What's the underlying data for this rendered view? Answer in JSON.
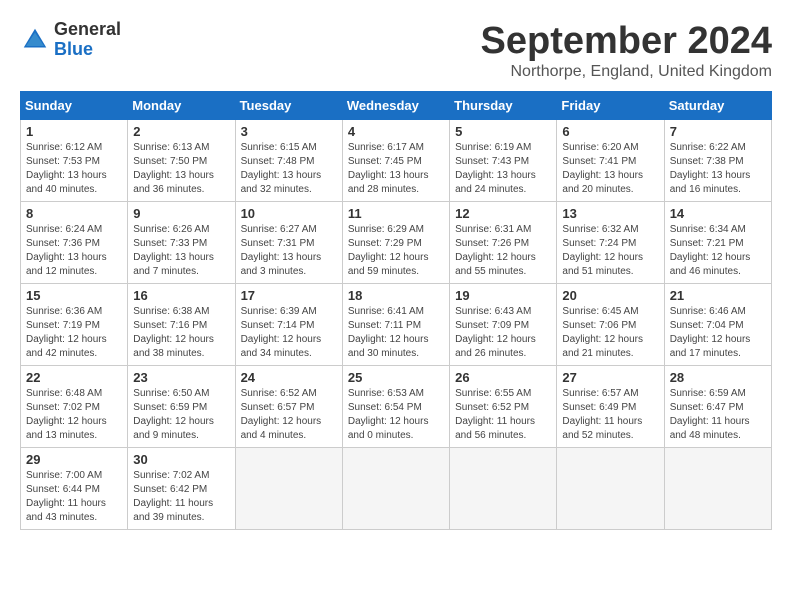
{
  "logo": {
    "line1": "General",
    "line2": "Blue"
  },
  "header": {
    "month": "September 2024",
    "location": "Northorpe, England, United Kingdom"
  },
  "weekdays": [
    "Sunday",
    "Monday",
    "Tuesday",
    "Wednesday",
    "Thursday",
    "Friday",
    "Saturday"
  ],
  "weeks": [
    [
      {
        "day": "1",
        "info": "Sunrise: 6:12 AM\nSunset: 7:53 PM\nDaylight: 13 hours\nand 40 minutes."
      },
      {
        "day": "2",
        "info": "Sunrise: 6:13 AM\nSunset: 7:50 PM\nDaylight: 13 hours\nand 36 minutes."
      },
      {
        "day": "3",
        "info": "Sunrise: 6:15 AM\nSunset: 7:48 PM\nDaylight: 13 hours\nand 32 minutes."
      },
      {
        "day": "4",
        "info": "Sunrise: 6:17 AM\nSunset: 7:45 PM\nDaylight: 13 hours\nand 28 minutes."
      },
      {
        "day": "5",
        "info": "Sunrise: 6:19 AM\nSunset: 7:43 PM\nDaylight: 13 hours\nand 24 minutes."
      },
      {
        "day": "6",
        "info": "Sunrise: 6:20 AM\nSunset: 7:41 PM\nDaylight: 13 hours\nand 20 minutes."
      },
      {
        "day": "7",
        "info": "Sunrise: 6:22 AM\nSunset: 7:38 PM\nDaylight: 13 hours\nand 16 minutes."
      }
    ],
    [
      {
        "day": "8",
        "info": "Sunrise: 6:24 AM\nSunset: 7:36 PM\nDaylight: 13 hours\nand 12 minutes."
      },
      {
        "day": "9",
        "info": "Sunrise: 6:26 AM\nSunset: 7:33 PM\nDaylight: 13 hours\nand 7 minutes."
      },
      {
        "day": "10",
        "info": "Sunrise: 6:27 AM\nSunset: 7:31 PM\nDaylight: 13 hours\nand 3 minutes."
      },
      {
        "day": "11",
        "info": "Sunrise: 6:29 AM\nSunset: 7:29 PM\nDaylight: 12 hours\nand 59 minutes."
      },
      {
        "day": "12",
        "info": "Sunrise: 6:31 AM\nSunset: 7:26 PM\nDaylight: 12 hours\nand 55 minutes."
      },
      {
        "day": "13",
        "info": "Sunrise: 6:32 AM\nSunset: 7:24 PM\nDaylight: 12 hours\nand 51 minutes."
      },
      {
        "day": "14",
        "info": "Sunrise: 6:34 AM\nSunset: 7:21 PM\nDaylight: 12 hours\nand 46 minutes."
      }
    ],
    [
      {
        "day": "15",
        "info": "Sunrise: 6:36 AM\nSunset: 7:19 PM\nDaylight: 12 hours\nand 42 minutes."
      },
      {
        "day": "16",
        "info": "Sunrise: 6:38 AM\nSunset: 7:16 PM\nDaylight: 12 hours\nand 38 minutes."
      },
      {
        "day": "17",
        "info": "Sunrise: 6:39 AM\nSunset: 7:14 PM\nDaylight: 12 hours\nand 34 minutes."
      },
      {
        "day": "18",
        "info": "Sunrise: 6:41 AM\nSunset: 7:11 PM\nDaylight: 12 hours\nand 30 minutes."
      },
      {
        "day": "19",
        "info": "Sunrise: 6:43 AM\nSunset: 7:09 PM\nDaylight: 12 hours\nand 26 minutes."
      },
      {
        "day": "20",
        "info": "Sunrise: 6:45 AM\nSunset: 7:06 PM\nDaylight: 12 hours\nand 21 minutes."
      },
      {
        "day": "21",
        "info": "Sunrise: 6:46 AM\nSunset: 7:04 PM\nDaylight: 12 hours\nand 17 minutes."
      }
    ],
    [
      {
        "day": "22",
        "info": "Sunrise: 6:48 AM\nSunset: 7:02 PM\nDaylight: 12 hours\nand 13 minutes."
      },
      {
        "day": "23",
        "info": "Sunrise: 6:50 AM\nSunset: 6:59 PM\nDaylight: 12 hours\nand 9 minutes."
      },
      {
        "day": "24",
        "info": "Sunrise: 6:52 AM\nSunset: 6:57 PM\nDaylight: 12 hours\nand 4 minutes."
      },
      {
        "day": "25",
        "info": "Sunrise: 6:53 AM\nSunset: 6:54 PM\nDaylight: 12 hours\nand 0 minutes."
      },
      {
        "day": "26",
        "info": "Sunrise: 6:55 AM\nSunset: 6:52 PM\nDaylight: 11 hours\nand 56 minutes."
      },
      {
        "day": "27",
        "info": "Sunrise: 6:57 AM\nSunset: 6:49 PM\nDaylight: 11 hours\nand 52 minutes."
      },
      {
        "day": "28",
        "info": "Sunrise: 6:59 AM\nSunset: 6:47 PM\nDaylight: 11 hours\nand 48 minutes."
      }
    ],
    [
      {
        "day": "29",
        "info": "Sunrise: 7:00 AM\nSunset: 6:44 PM\nDaylight: 11 hours\nand 43 minutes."
      },
      {
        "day": "30",
        "info": "Sunrise: 7:02 AM\nSunset: 6:42 PM\nDaylight: 11 hours\nand 39 minutes."
      },
      {
        "day": "",
        "info": ""
      },
      {
        "day": "",
        "info": ""
      },
      {
        "day": "",
        "info": ""
      },
      {
        "day": "",
        "info": ""
      },
      {
        "day": "",
        "info": ""
      }
    ]
  ]
}
